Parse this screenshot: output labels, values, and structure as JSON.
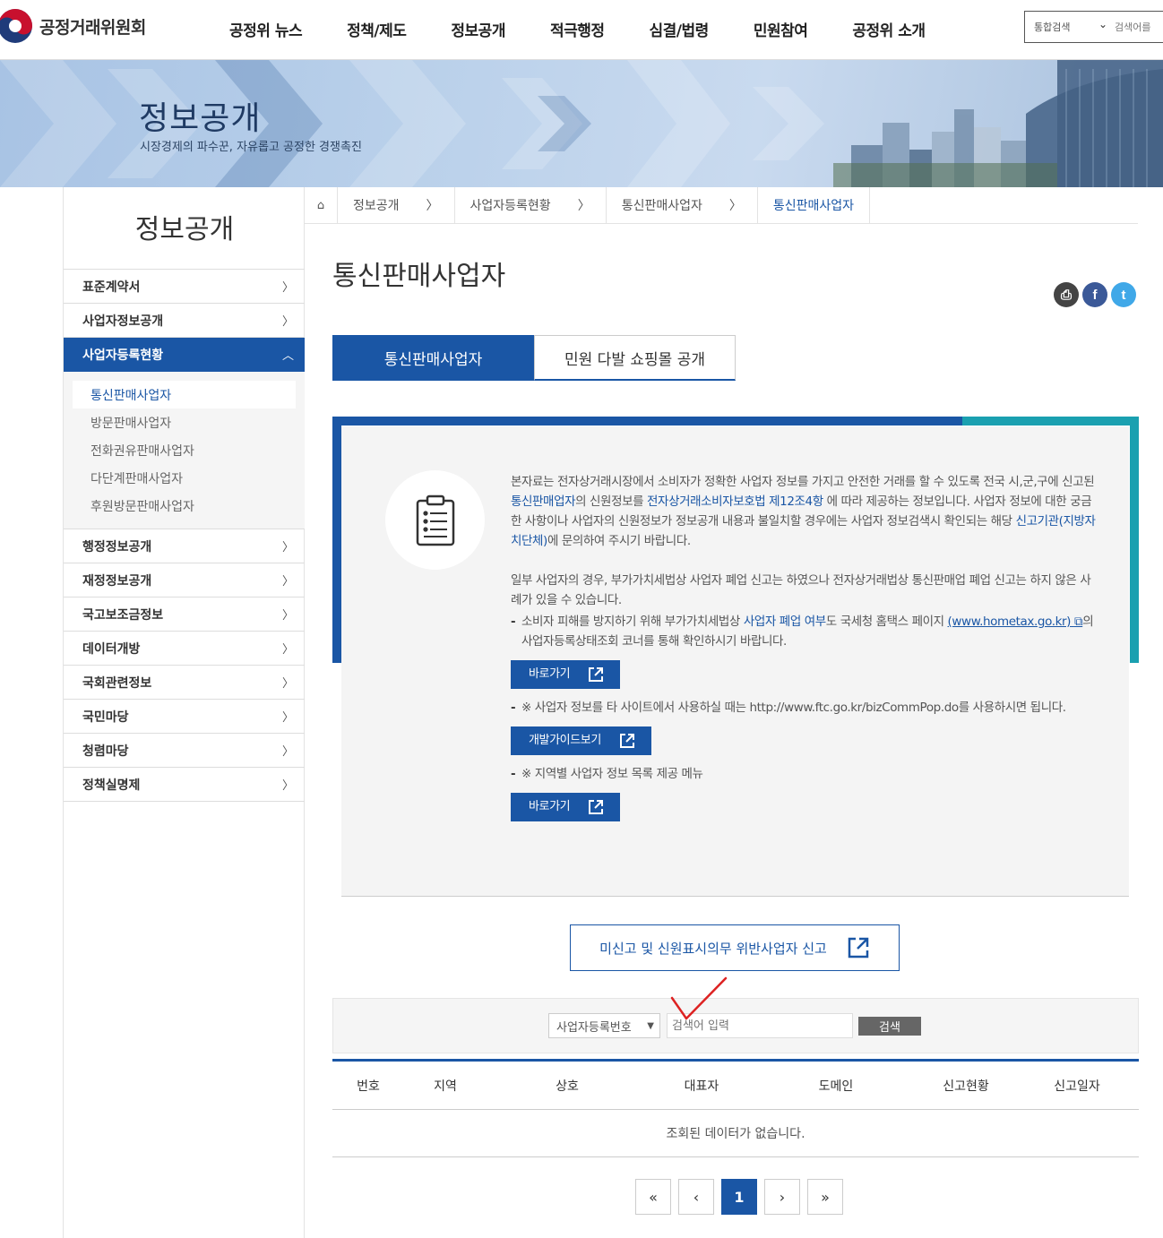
{
  "site": {
    "logo_text": "공정거래위원회",
    "menu": [
      "공정위 뉴스",
      "정책/제도",
      "정보공개",
      "적극행정",
      "심결/법령",
      "민원참여",
      "공정위 소개"
    ],
    "search_scope": "통합검색",
    "search_placeholder": "검색어를"
  },
  "banner": {
    "title": "정보공개",
    "subtitle": "시장경제의 파수꾼, 자유롭고 공정한 경쟁촉진"
  },
  "sidebar": {
    "title": "정보공개",
    "items_top": [
      "표준계약서",
      "사업자정보공개"
    ],
    "active_item": "사업자등록현황",
    "sub_items": [
      "통신판매사업자",
      "방문판매사업자",
      "전화권유판매사업자",
      "다단계판매사업자",
      "후원방문판매사업자"
    ],
    "items_bottom": [
      "행정정보공개",
      "재정정보공개",
      "국고보조금정보",
      "데이터개방",
      "국회관련정보",
      "국민마당",
      "청렴마당",
      "정책실명제"
    ]
  },
  "breadcrumb": [
    "정보공개",
    "사업자등록현황",
    "통신판매사업자",
    "통신판매사업자"
  ],
  "page": {
    "title": "통신판매사업자",
    "tabs": [
      "통신판매사업자",
      "민원 다발 쇼핑몰 공개"
    ]
  },
  "info": {
    "p1_a": "본자료는 전자상거래시장에서 소비자가 정확한 사업자 정보를 가지고 안전한 거래를 할 수 있도록 전국 시,군,구에 신고된 ",
    "p1_hl1": "통신판매업자",
    "p1_b": "의 신원정보를 ",
    "p1_hl2": "전자상거래소비자보호법 제12조4항",
    "p1_c": " 에 따라 제공하는 정보입니다. 사업자 정보에 대한 궁금한 사항이나 사업자의 신원정보가 정보공개 내용과 불일치할 경우에는 사업자 정보검색시 확인되는 해당 ",
    "p1_hl3": "신고기관(지방자치단체)",
    "p1_d": "에 문의하여 주시기 바랍니다.",
    "p2": "일부 사업자의 경우, 부가가치세법상 사업자 폐업 신고는 하였으나 전자상거래법상 통신판매업 폐업 신고는 하지 않은 사례가 있을 수 있습니다.",
    "d1_a": "소비자 피해를 방지하기 위해 부가가치세법상 ",
    "d1_hl": "사업자 폐업 여부",
    "d1_b": "도 국세청 홈택스 페이지 ",
    "d1_link": "(www.hometax.go.kr)",
    "d1_c": "의 사업자등록상태조회 코너를 통해 확인하시기 바랍니다.",
    "btn1": "바로가기",
    "d2": "※ 사업자 정보를 타 사이트에서 사용하실 때는 http://www.ftc.go.kr/bizCommPop.do를 사용하시면 됩니다.",
    "btn2": "개발가이드보기",
    "d3": "※ 지역별 사업자 정보 목록 제공 메뉴",
    "btn3": "바로가기"
  },
  "report_button": "미신고 및 신원표시의무 위반사업자 신고",
  "search": {
    "field_select": "사업자등록번호",
    "placeholder": "검색어 입력",
    "button": "검색"
  },
  "table": {
    "headers": [
      "번호",
      "지역",
      "상호",
      "대표자",
      "도메인",
      "신고현황",
      "신고일자"
    ],
    "empty_message": "조회된 데이터가 없습니다."
  },
  "pagination": {
    "first": "«",
    "prev": "‹",
    "current": "1",
    "next": "›",
    "last": "»"
  },
  "colors": {
    "primary": "#1a56a5",
    "teal": "#1aa0b0",
    "check": "#d22"
  }
}
